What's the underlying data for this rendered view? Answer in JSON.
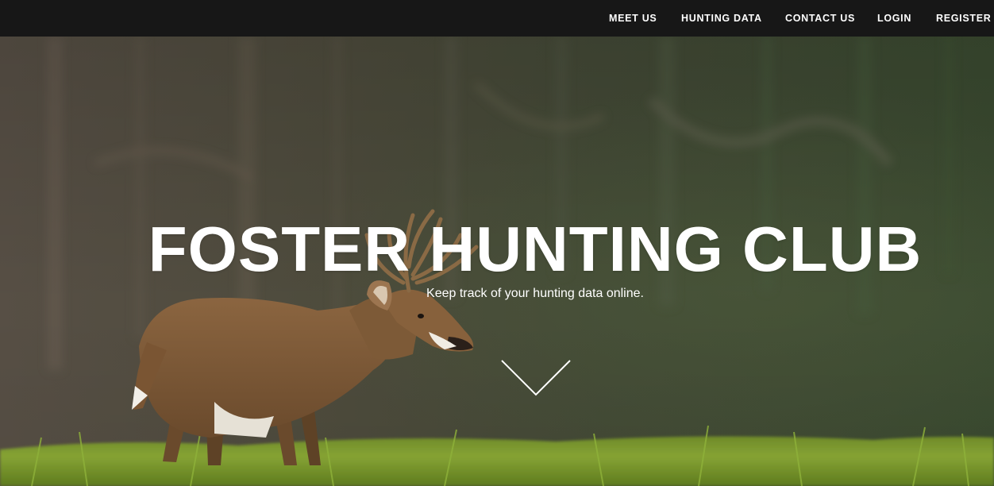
{
  "nav": {
    "items": [
      {
        "label": "MEET US"
      },
      {
        "label": "HUNTING DATA"
      },
      {
        "label": "CONTACT US"
      },
      {
        "label": "LOGIN"
      },
      {
        "label": "REGISTER"
      }
    ]
  },
  "hero": {
    "title": "FOSTER HUNTING CLUB",
    "tagline": "Keep track of your hunting data online.",
    "scroll_icon": "chevron-down-icon",
    "background_image": "whitetail-buck-in-meadow"
  },
  "colors": {
    "navbar_bg": "#171717",
    "nav_text": "#ffffff",
    "hero_text": "#ffffff"
  }
}
